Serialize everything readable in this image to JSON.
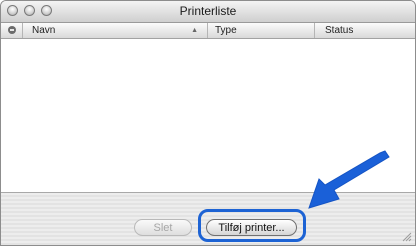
{
  "window": {
    "title": "Printerliste"
  },
  "table": {
    "columns": [
      {
        "label": "Navn",
        "sorted": true
      },
      {
        "label": "Type"
      },
      {
        "label": "Status"
      }
    ],
    "sort_indicator": "▲",
    "rows": []
  },
  "buttons": {
    "delete_label": "Slet",
    "delete_enabled": false,
    "add_label": "Tilføj printer..."
  },
  "icons": {
    "column_header": "printer-status-icon",
    "annotation": "blue-arrow-icon",
    "resize": "resize-grip-icon"
  },
  "colors": {
    "highlight": "#1d63d4",
    "arrow": "#1a60d8"
  }
}
